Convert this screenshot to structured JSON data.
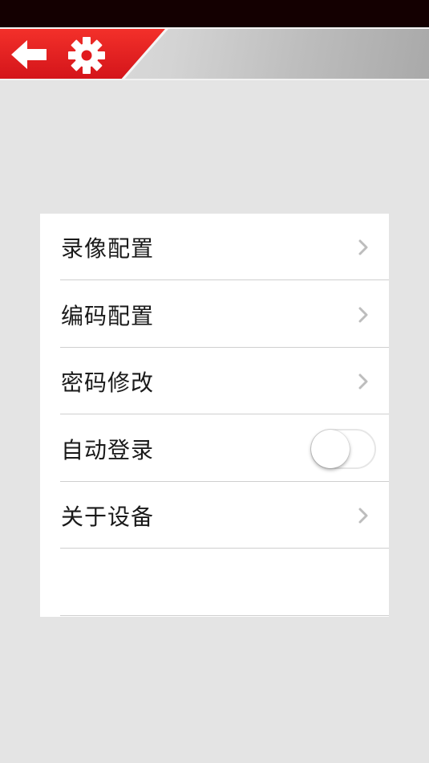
{
  "header": {
    "back_icon": "arrow-left-icon",
    "settings_icon": "gear-icon",
    "accent_color": "#e61e1e"
  },
  "settings": {
    "items": [
      {
        "label": "录像配置",
        "type": "link",
        "icon": "chevron-right-icon"
      },
      {
        "label": "编码配置",
        "type": "link",
        "icon": "chevron-right-icon"
      },
      {
        "label": "密码修改",
        "type": "link",
        "icon": "chevron-right-icon"
      },
      {
        "label": "自动登录",
        "type": "toggle",
        "on": false
      },
      {
        "label": "关于设备",
        "type": "link",
        "icon": "chevron-right-icon"
      }
    ]
  }
}
